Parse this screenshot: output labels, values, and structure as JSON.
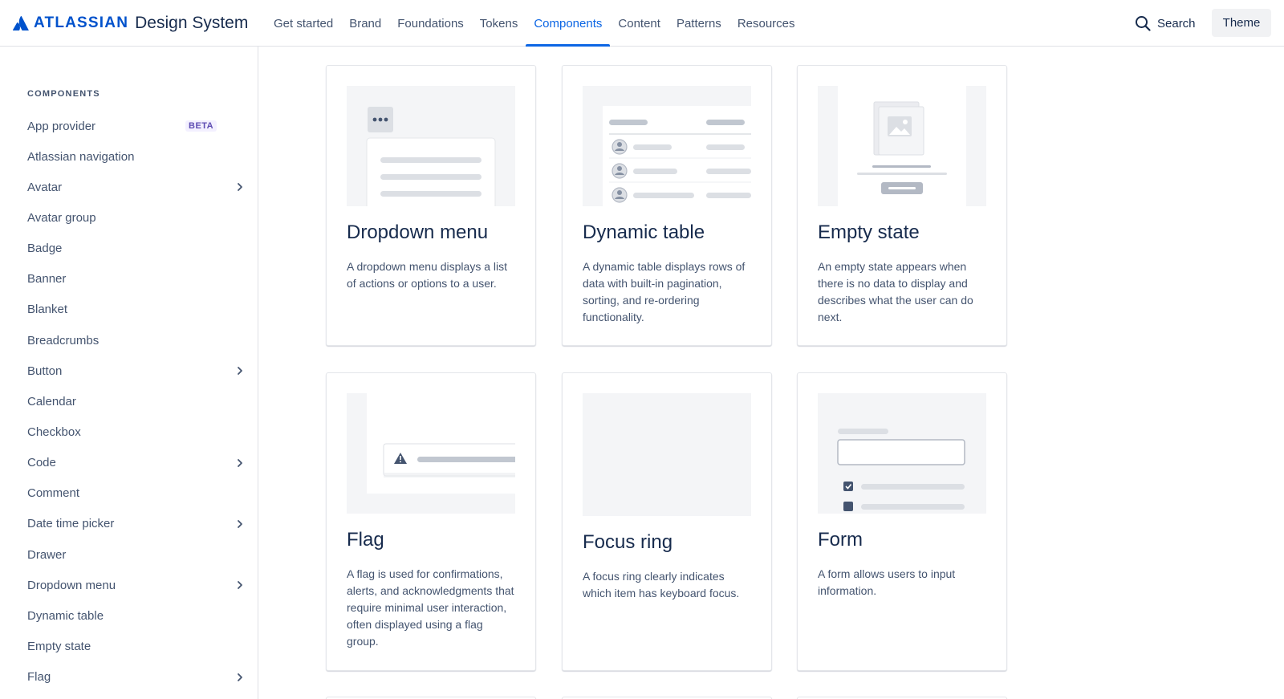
{
  "header": {
    "brand": "ATLASSIAN",
    "product": "Design System",
    "nav": [
      "Get started",
      "Brand",
      "Foundations",
      "Tokens",
      "Components",
      "Content",
      "Patterns",
      "Resources"
    ],
    "active_nav": "Components",
    "search_label": "Search",
    "theme_label": "Theme"
  },
  "sidebar": {
    "heading": "COMPONENTS",
    "items": [
      {
        "label": "App provider",
        "badge": "BETA",
        "expandable": false
      },
      {
        "label": "Atlassian navigation",
        "expandable": false
      },
      {
        "label": "Avatar",
        "expandable": true
      },
      {
        "label": "Avatar group",
        "expandable": false
      },
      {
        "label": "Badge",
        "expandable": false
      },
      {
        "label": "Banner",
        "expandable": false
      },
      {
        "label": "Blanket",
        "expandable": false
      },
      {
        "label": "Breadcrumbs",
        "expandable": false
      },
      {
        "label": "Button",
        "expandable": true
      },
      {
        "label": "Calendar",
        "expandable": false
      },
      {
        "label": "Checkbox",
        "expandable": false
      },
      {
        "label": "Code",
        "expandable": true
      },
      {
        "label": "Comment",
        "expandable": false
      },
      {
        "label": "Date time picker",
        "expandable": true
      },
      {
        "label": "Drawer",
        "expandable": false
      },
      {
        "label": "Dropdown menu",
        "expandable": true
      },
      {
        "label": "Dynamic table",
        "expandable": false
      },
      {
        "label": "Empty state",
        "expandable": false
      },
      {
        "label": "Flag",
        "expandable": true
      }
    ]
  },
  "cards": [
    {
      "title": "Dropdown menu",
      "description": "A dropdown menu displays a list of actions or options to a user."
    },
    {
      "title": "Dynamic table",
      "description": "A dynamic table displays rows of data with built-in pagination, sorting, and re-ordering functionality."
    },
    {
      "title": "Empty state",
      "description": "An empty state appears when there is no data to display and describes what the user can do next."
    },
    {
      "title": "Flag",
      "description": "A flag is used for confirmations, alerts, and acknowledgments that require minimal user interaction, often displayed using a flag group."
    },
    {
      "title": "Focus ring",
      "description": "A focus ring clearly indicates which item has keyboard focus."
    },
    {
      "title": "Form",
      "description": "A form allows users to input information."
    }
  ],
  "colors": {
    "brand": "#0052cc",
    "active_nav": "#0c66e4",
    "text": "#172b4d",
    "subtle_text": "#44546f",
    "beta_badge": "#5e4db2"
  }
}
